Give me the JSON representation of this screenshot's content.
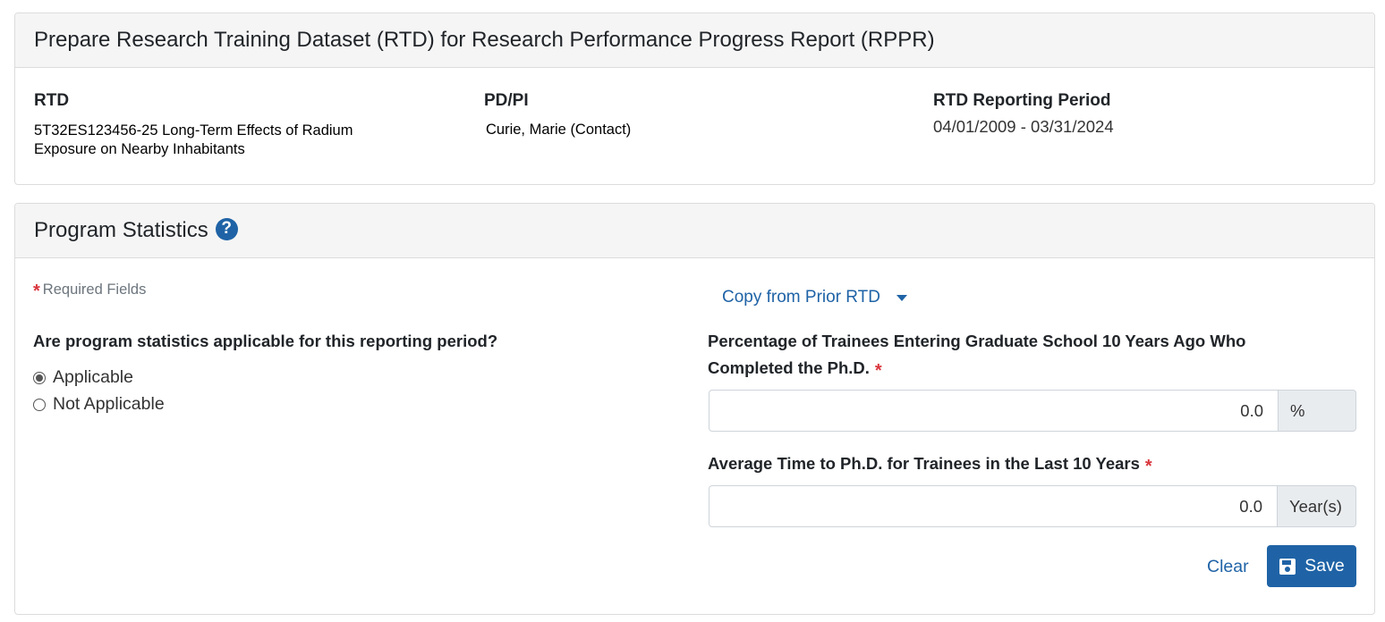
{
  "rtd_panel": {
    "title": "Prepare Research Training Dataset (RTD) for Research Performance Progress Report (RPPR)",
    "rtd": {
      "label": "RTD",
      "value_line1": "5T32ES123456-25 Long-Term Effects of Radium",
      "value_line2": "Exposure on Nearby Inhabitants"
    },
    "pdpi": {
      "label": "PD/PI",
      "value": "Curie, Marie (Contact)"
    },
    "period": {
      "label": "RTD Reporting Period",
      "value": "04/01/2009 - 03/31/2024"
    }
  },
  "stats_panel": {
    "title": "Program Statistics",
    "help_icon": "question-circle-icon",
    "help_glyph": "?",
    "required_star": "*",
    "required_note": "Required Fields",
    "copy_link": "Copy from Prior RTD",
    "question": "Are program statistics applicable for this reporting period?",
    "radio_options": [
      {
        "label": "Applicable",
        "checked": true
      },
      {
        "label": "Not Applicable",
        "checked": false
      }
    ],
    "fields": [
      {
        "label_line1": "Percentage of Trainees Entering Graduate School 10 Years Ago Who",
        "label_line2": "Completed the Ph.D.",
        "value": "0.0",
        "addon": "%"
      },
      {
        "label": "Average Time to Ph.D. for Trainees in the Last 10 Years",
        "value": "0.0",
        "addon": "Year(s)"
      }
    ],
    "clear_label": "Clear",
    "save_label": "Save",
    "save_icon": "floppy-disk-icon"
  },
  "colors": {
    "primary": "#1f63a6",
    "required": "#d9353c",
    "header_bg": "#f5f5f5",
    "addon_bg": "#e9ecef"
  }
}
